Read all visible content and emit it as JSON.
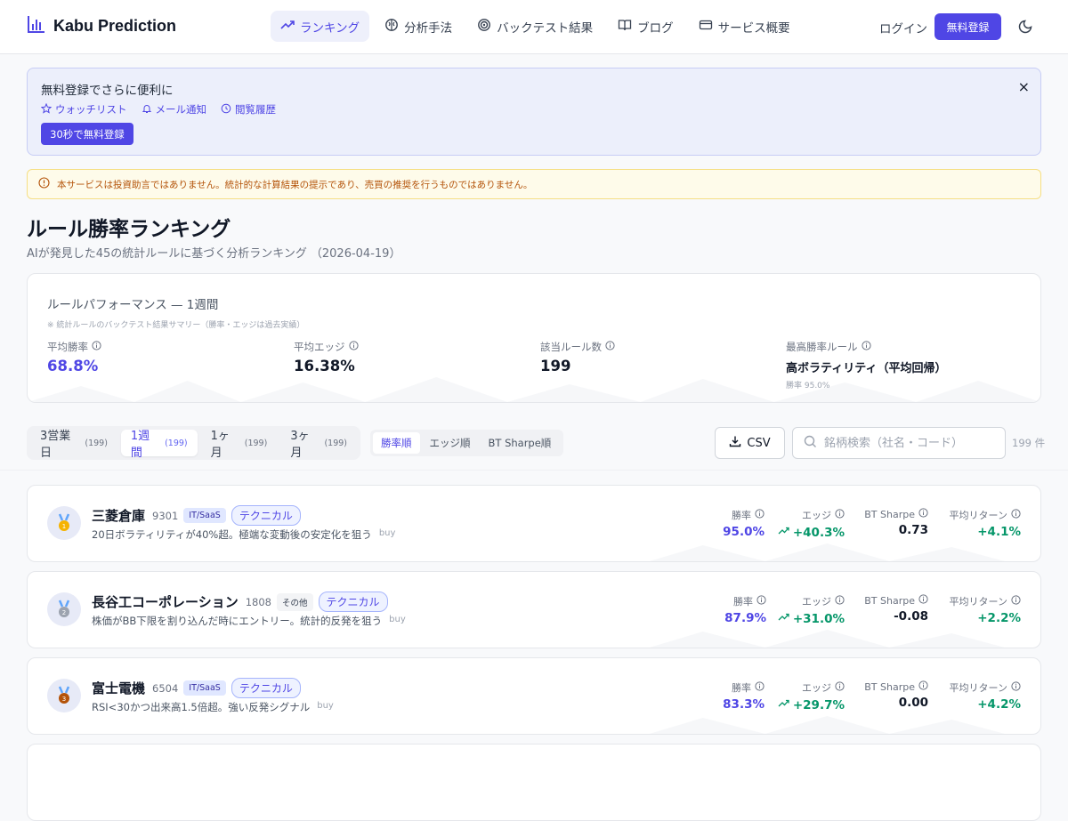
{
  "header": {
    "brand": "Kabu Prediction",
    "nav": [
      {
        "label": "ランキング",
        "icon": "trending-up-icon",
        "active": true
      },
      {
        "label": "分析手法",
        "icon": "brain-icon",
        "active": false
      },
      {
        "label": "バックテスト結果",
        "icon": "target-icon",
        "active": false
      },
      {
        "label": "ブログ",
        "icon": "book-icon",
        "active": false
      },
      {
        "label": "サービス概要",
        "icon": "card-icon",
        "active": false
      }
    ],
    "login": "ログイン",
    "signup": "無料登録",
    "theme_icon": "moon-icon"
  },
  "promo": {
    "title": "無料登録でさらに便利に",
    "links": [
      "ウォッチリスト",
      "メール通知",
      "閲覧履歴"
    ],
    "cta": "30秒で無料登録",
    "close": "×"
  },
  "disclaimer": "本サービスは投資助言ではありません。統計的な計算結果の提示であり、売買の推奨を行うものではありません。",
  "page": {
    "title": "ルール勝率ランキング",
    "subtitle": "AIが発見した45の統計ルールに基づく分析ランキング",
    "date": "（2026-04-19）"
  },
  "performance": {
    "title": "ルールパフォーマンス — 1週間",
    "note": "※ 統計ルールのバックテスト結果サマリー（勝率・エッジは過去実績）",
    "stats": [
      {
        "label": "平均勝率",
        "value": "68.8%"
      },
      {
        "label": "平均エッジ",
        "value": "16.38%"
      },
      {
        "label": "該当ルール数",
        "value": "199"
      },
      {
        "label": "最高勝率ルール",
        "value": "高ボラティリティ（平均回帰）",
        "sub": "勝率 95.0%"
      }
    ]
  },
  "toolbar": {
    "periods": [
      {
        "label": "3営業日",
        "count": "(199)",
        "active": false
      },
      {
        "label": "1週間",
        "count": "(199)",
        "active": true
      },
      {
        "label": "1ヶ月",
        "count": "(199)",
        "active": false
      },
      {
        "label": "3ヶ月",
        "count": "(199)",
        "active": false
      }
    ],
    "sorts": [
      {
        "label": "勝率順",
        "active": true
      },
      {
        "label": "エッジ順",
        "active": false
      },
      {
        "label": "BT Sharpe順",
        "active": false
      }
    ],
    "csv": "CSV",
    "search_placeholder": "銘柄検索（社名・コード）",
    "result_count": "199 件"
  },
  "metric_labels": {
    "win": "勝率",
    "edge": "エッジ",
    "sharpe": "BT Sharpe",
    "return": "平均リターン"
  },
  "rows": [
    {
      "rank": 1,
      "medal_color": "#f5b301",
      "name": "三菱倉庫",
      "code": "9301",
      "sector": "IT/SaaS",
      "tag": "テクニカル",
      "desc": "20日ボラティリティが40%超。極端な変動後の安定化を狙う",
      "signal": "buy",
      "win": "95.0%",
      "edge": "+40.3%",
      "sharpe": "0.73",
      "return": "+4.1%"
    },
    {
      "rank": 2,
      "medal_color": "#9ca3af",
      "name": "長谷工コーポレーション",
      "code": "1808",
      "sector": "その他",
      "tag": "テクニカル",
      "desc": "株価がBB下限を割り込んだ時にエントリー。統計的反発を狙う",
      "signal": "buy",
      "win": "87.9%",
      "edge": "+31.0%",
      "sharpe": "-0.08",
      "return": "+2.2%"
    },
    {
      "rank": 3,
      "medal_color": "#b45309",
      "name": "富士電機",
      "code": "6504",
      "sector": "IT/SaaS",
      "tag": "テクニカル",
      "desc": "RSI<30かつ出来高1.5倍超。強い反発シグナル",
      "signal": "buy",
      "win": "83.3%",
      "edge": "+29.7%",
      "sharpe": "0.00",
      "return": "+4.2%"
    }
  ]
}
